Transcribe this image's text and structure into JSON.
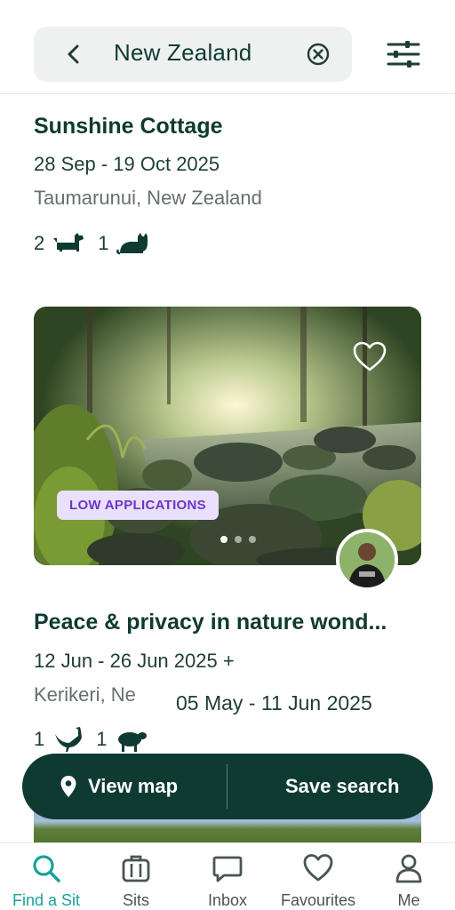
{
  "search": {
    "value": "New Zealand"
  },
  "listings": [
    {
      "title": "Sunshine Cottage",
      "dates": "28 Sep - 19 Oct 2025",
      "location": "Taumarunui, New Zealand",
      "pets": [
        {
          "count": "2",
          "icon": "dog-icon"
        },
        {
          "count": "1",
          "icon": "cat-icon"
        }
      ]
    },
    {
      "badge": "LOW APPLICATIONS",
      "title": "Peace & privacy in nature wond...",
      "dates": "12 Jun - 26 Jun 2025 +",
      "location": "Kerikeri, Ne",
      "alt_dates": "05 May - 11 Jun 2025",
      "photo_dots": 3,
      "active_dot": 0,
      "pets": [
        {
          "count": "1",
          "icon": "chicken-icon"
        },
        {
          "count": "1",
          "icon": "sheep-icon"
        }
      ]
    }
  ],
  "actions": {
    "view_map": "View map",
    "save_search": "Save search"
  },
  "nav": [
    {
      "label": "Find a Sit",
      "icon": "search-icon",
      "active": true
    },
    {
      "label": "Sits",
      "icon": "suitcase-icon",
      "active": false
    },
    {
      "label": "Inbox",
      "icon": "chat-icon",
      "active": false
    },
    {
      "label": "Favourites",
      "icon": "heart-icon",
      "active": false
    },
    {
      "label": "Me",
      "icon": "user-icon",
      "active": false
    }
  ],
  "colors": {
    "brand": "#0f3a32",
    "accent": "#17a29a",
    "badge_bg": "#e9e0fb",
    "badge_text": "#6a38c9"
  }
}
